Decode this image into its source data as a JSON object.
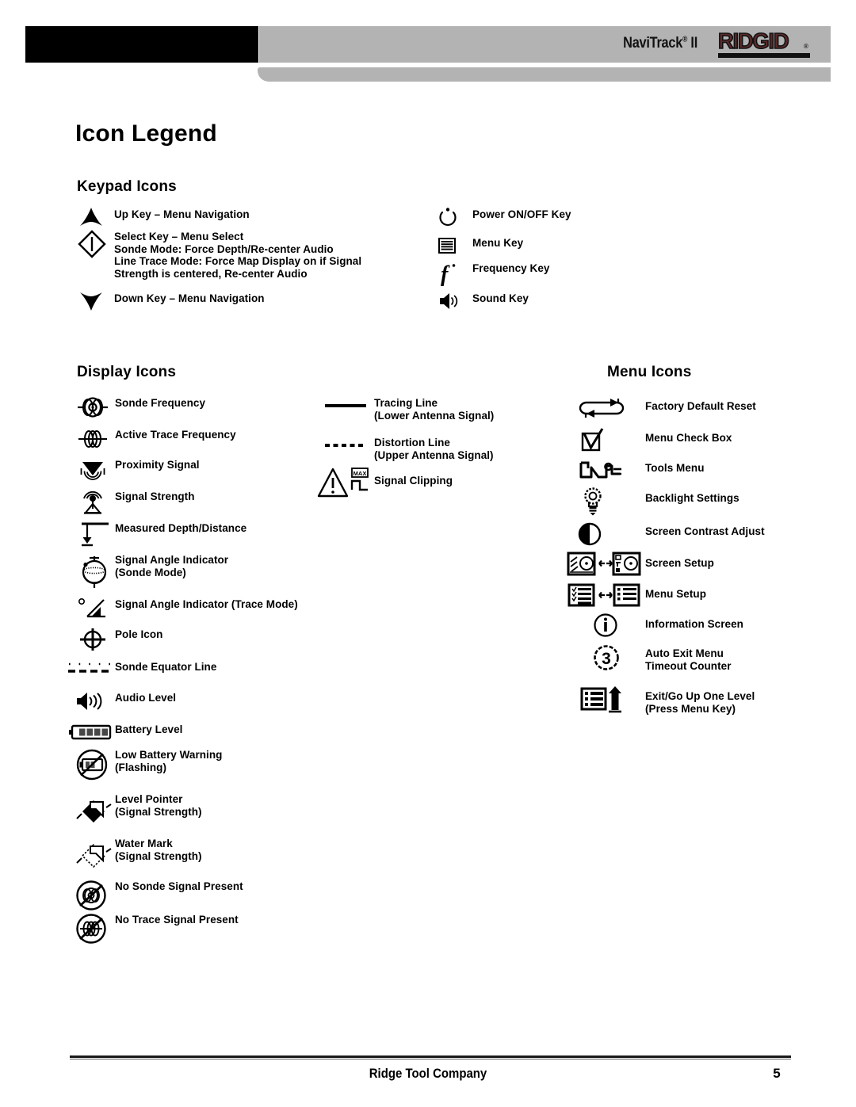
{
  "header": {
    "product_name": "NaviTrack",
    "registered_mark": "®",
    "model": "II",
    "brand_logo_text": "RIDGID",
    "brand_logo_mark": "®",
    "colors": {
      "bar_gray": "#b3b3b3",
      "bar_black": "#000000",
      "logo_red": "#5c2a2a"
    }
  },
  "page": {
    "title": "Icon Legend"
  },
  "sections": {
    "keypad": {
      "title": "Keypad Icons",
      "left_items": [
        {
          "icon": "up-arrow-icon",
          "label": "Up Key – Menu Navigation"
        },
        {
          "icon": "select-diamond-icon",
          "label": "Select Key – Menu Select\nSonde Mode: Force Depth/Re-center Audio\nLine Trace Mode: Force Map Display on if Signal\nStrength is centered, Re-center Audio"
        },
        {
          "icon": "down-arrow-icon",
          "label": "Down Key – Menu Navigation"
        }
      ],
      "right_items": [
        {
          "icon": "power-icon",
          "label": "Power ON/OFF Key"
        },
        {
          "icon": "menu-lines-icon",
          "label": "Menu Key"
        },
        {
          "icon": "frequency-f-icon",
          "label": "Frequency Key"
        },
        {
          "icon": "sound-speaker-icon",
          "label": "Sound Key"
        }
      ]
    },
    "display": {
      "title": "Display Icons",
      "left_items": [
        {
          "icon": "sonde-frequency-icon",
          "label": "Sonde Frequency"
        },
        {
          "icon": "active-trace-frequency-icon",
          "label": "Active Trace Frequency"
        },
        {
          "icon": "proximity-signal-icon",
          "label": "Proximity Signal"
        },
        {
          "icon": "signal-strength-icon",
          "label": "Signal Strength"
        },
        {
          "icon": "measured-depth-icon",
          "label": "Measured Depth/Distance"
        },
        {
          "icon": "signal-angle-sonde-icon",
          "label": "Signal Angle Indicator\n(Sonde Mode)"
        },
        {
          "icon": "signal-angle-trace-icon",
          "label": "Signal Angle Indicator (Trace Mode)"
        },
        {
          "icon": "pole-icon",
          "label": "Pole Icon"
        },
        {
          "icon": "sonde-equator-line-icon",
          "label": "Sonde Equator Line"
        },
        {
          "icon": "audio-level-icon",
          "label": "Audio Level"
        },
        {
          "icon": "battery-level-icon",
          "label": "Battery Level"
        },
        {
          "icon": "low-battery-warning-icon",
          "label": "Low Battery Warning\n(Flashing)"
        },
        {
          "icon": "level-pointer-icon",
          "label": "Level Pointer\n(Signal Strength)"
        },
        {
          "icon": "water-mark-icon",
          "label": "Water Mark\n(Signal Strength)"
        },
        {
          "icon": "no-sonde-signal-icon",
          "label": "No Sonde Signal Present"
        },
        {
          "icon": "no-trace-signal-icon",
          "label": "No Trace Signal Present"
        }
      ],
      "middle_items": [
        {
          "icon": "tracing-line-icon",
          "label": "Tracing Line\n(Lower Antenna Signal)"
        },
        {
          "icon": "distortion-line-icon",
          "label": "Distortion Line\n(Upper Antenna Signal)"
        },
        {
          "icon": "signal-clipping-icon",
          "label": "Signal Clipping",
          "badge": "MAX"
        }
      ]
    },
    "menu": {
      "title": "Menu Icons",
      "items": [
        {
          "icon": "factory-reset-icon",
          "label": "Factory Default Reset"
        },
        {
          "icon": "menu-check-box-icon",
          "label": "Menu Check Box"
        },
        {
          "icon": "tools-menu-icon",
          "label": "Tools Menu"
        },
        {
          "icon": "backlight-bulb-icon",
          "label": "Backlight Settings"
        },
        {
          "icon": "screen-contrast-icon",
          "label": "Screen Contrast Adjust"
        },
        {
          "icon": "screen-setup-icon",
          "label": "Screen Setup"
        },
        {
          "icon": "menu-setup-icon",
          "label": "Menu Setup"
        },
        {
          "icon": "information-screen-icon",
          "label": "Information Screen"
        },
        {
          "icon": "auto-exit-timer-icon",
          "label": "Auto Exit Menu\nTimeout Counter",
          "counter": "3"
        },
        {
          "icon": "exit-up-one-level-icon",
          "label": "Exit/Go Up One Level\n(Press Menu Key)"
        }
      ]
    }
  },
  "footer": {
    "company": "Ridge Tool Company",
    "page_number": "5"
  }
}
